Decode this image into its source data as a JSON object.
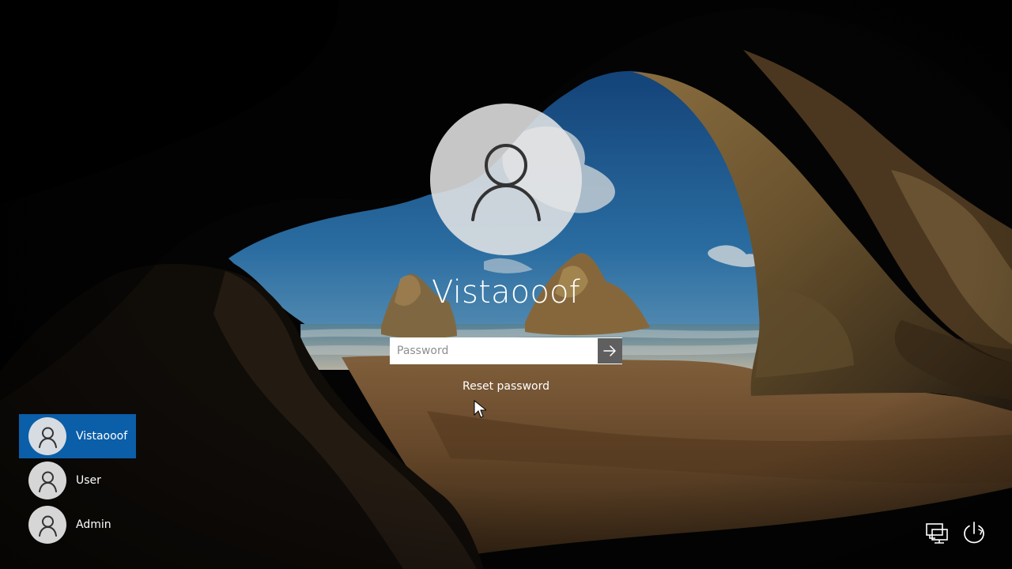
{
  "login": {
    "user_name": "Vistaooof",
    "password_placeholder": "Password",
    "reset_password_label": "Reset password"
  },
  "user_list": [
    {
      "label": "Vistaooof",
      "active": true
    },
    {
      "label": "User",
      "active": false
    },
    {
      "label": "Admin",
      "active": false
    }
  ],
  "icons": {
    "avatar": "user-silhouette-icon",
    "submit": "arrow-right-icon",
    "network": "network-icon",
    "power": "power-icon",
    "cursor": "mouse-cursor-icon"
  },
  "colors": {
    "selected_user_background": "#0b5ea8",
    "text": "#ffffff",
    "avatar_background": "#e6e6e6",
    "submit_background": "#5f5f5f"
  }
}
